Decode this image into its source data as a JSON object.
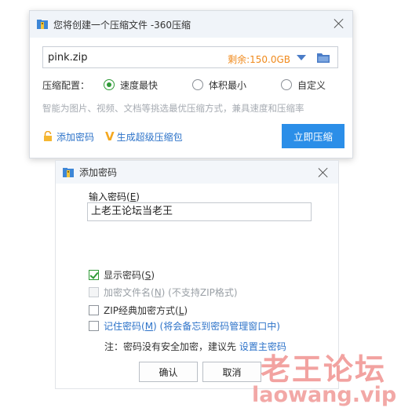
{
  "compress_window": {
    "title": "您将创建一个压缩文件 -360压缩",
    "filename": "pink.zip",
    "free_space": "剩余:150.0GB",
    "config_label": "压缩配置：",
    "options": [
      "速度最快",
      "体积最小",
      "自定义"
    ],
    "selected_option": "速度最快",
    "description": "智能为图片、视频、文档等挑选最优压缩方式，兼具速度和压缩率",
    "add_password_link": "添加密码",
    "super_zip_link": "生成超级压缩包",
    "compress_button": "立即压缩"
  },
  "password_dialog": {
    "title": "添加密码",
    "input_label": "输入密码(",
    "input_label_key": "E",
    "input_label_end": ")",
    "password_value": "上老王论坛当老王",
    "show_password": {
      "label": "显示密码(",
      "key": "S",
      "end": ")",
      "checked": true
    },
    "encrypt_filename": {
      "label": "加密文件名(",
      "key": "N",
      "end": ") (不支持ZIP格式)",
      "checked": false,
      "disabled": true
    },
    "zip_classic": {
      "label": "ZIP经典加密方式(",
      "key": "L",
      "end": ")",
      "checked": false
    },
    "remember_password": {
      "label": "记住密码(",
      "key": "M",
      "end": ") (将会备忘到密码管理窗口中)",
      "checked": false
    },
    "note_text": "注：密码没有安全加密，建议先",
    "note_link": "设置主密码",
    "ok_button": "确认",
    "cancel_button": "取消"
  },
  "watermark": {
    "title": "老王论坛",
    "url": "laowang.vip"
  },
  "colors": {
    "accent": "#2b8ee8",
    "link": "#2d73c9",
    "free_space": "#f08a1c",
    "checked_green": "#2f9a37",
    "watermark": "#f2a2a0"
  }
}
